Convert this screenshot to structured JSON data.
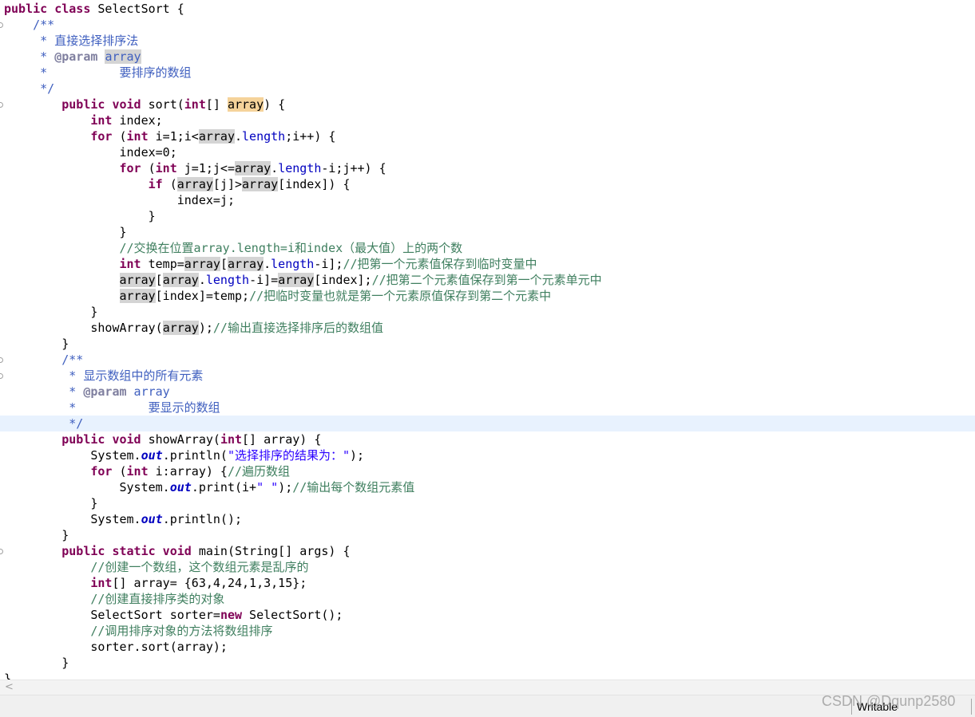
{
  "editor": {
    "current_line_index": 26,
    "fold_markers": [
      1,
      6,
      22,
      23,
      34
    ],
    "lines": [
      [
        {
          "c": "kw",
          "t": "public class"
        },
        {
          "c": "",
          "t": " SelectSort {"
        }
      ],
      [
        {
          "c": "",
          "t": "    "
        },
        {
          "c": "jd",
          "t": "/**"
        }
      ],
      [
        {
          "c": "jd",
          "t": "     * 直接选择排序法"
        }
      ],
      [
        {
          "c": "jd",
          "t": "     * "
        },
        {
          "c": "jt",
          "t": "@param"
        },
        {
          "c": "jd",
          "t": " "
        },
        {
          "c": "jd occ",
          "t": "array"
        }
      ],
      [
        {
          "c": "jd",
          "t": "     *          要排序的数组"
        }
      ],
      [
        {
          "c": "jd",
          "t": "     */"
        }
      ],
      [
        {
          "c": "",
          "t": "        "
        },
        {
          "c": "kw",
          "t": "public void"
        },
        {
          "c": "",
          "t": " sort("
        },
        {
          "c": "kw",
          "t": "int"
        },
        {
          "c": "",
          "t": "[] "
        },
        {
          "c": "occ-w",
          "t": "array"
        },
        {
          "c": "",
          "t": ") {"
        }
      ],
      [
        {
          "c": "",
          "t": "            "
        },
        {
          "c": "kw",
          "t": "int"
        },
        {
          "c": "",
          "t": " index;"
        }
      ],
      [
        {
          "c": "",
          "t": "            "
        },
        {
          "c": "kw",
          "t": "for"
        },
        {
          "c": "",
          "t": " ("
        },
        {
          "c": "kw",
          "t": "int"
        },
        {
          "c": "",
          "t": " i=1;i<"
        },
        {
          "c": "occ",
          "t": "array"
        },
        {
          "c": "",
          "t": "."
        },
        {
          "c": "fd",
          "t": "length"
        },
        {
          "c": "",
          "t": ";i++) {"
        }
      ],
      [
        {
          "c": "",
          "t": "                index=0;"
        }
      ],
      [
        {
          "c": "",
          "t": "                "
        },
        {
          "c": "kw",
          "t": "for"
        },
        {
          "c": "",
          "t": " ("
        },
        {
          "c": "kw",
          "t": "int"
        },
        {
          "c": "",
          "t": " j=1;j<="
        },
        {
          "c": "occ",
          "t": "array"
        },
        {
          "c": "",
          "t": "."
        },
        {
          "c": "fd",
          "t": "length"
        },
        {
          "c": "",
          "t": "-i;j++) {"
        }
      ],
      [
        {
          "c": "",
          "t": "                    "
        },
        {
          "c": "kw",
          "t": "if"
        },
        {
          "c": "",
          "t": " ("
        },
        {
          "c": "occ",
          "t": "array"
        },
        {
          "c": "",
          "t": "[j]>"
        },
        {
          "c": "occ",
          "t": "array"
        },
        {
          "c": "",
          "t": "[index]) {"
        }
      ],
      [
        {
          "c": "",
          "t": "                        index=j;"
        }
      ],
      [
        {
          "c": "",
          "t": "                    }"
        }
      ],
      [
        {
          "c": "",
          "t": "                }"
        }
      ],
      [
        {
          "c": "",
          "t": "                "
        },
        {
          "c": "cm",
          "t": "//交换在位置array.length=i和index（最大值）上的两个数"
        }
      ],
      [
        {
          "c": "",
          "t": "                "
        },
        {
          "c": "kw",
          "t": "int"
        },
        {
          "c": "",
          "t": " temp="
        },
        {
          "c": "occ",
          "t": "array"
        },
        {
          "c": "",
          "t": "["
        },
        {
          "c": "occ",
          "t": "array"
        },
        {
          "c": "",
          "t": "."
        },
        {
          "c": "fd",
          "t": "length"
        },
        {
          "c": "",
          "t": "-i];"
        },
        {
          "c": "cm",
          "t": "//把第一个元素值保存到临时变量中"
        }
      ],
      [
        {
          "c": "",
          "t": "                "
        },
        {
          "c": "occ",
          "t": "array"
        },
        {
          "c": "",
          "t": "["
        },
        {
          "c": "occ",
          "t": "array"
        },
        {
          "c": "",
          "t": "."
        },
        {
          "c": "fd",
          "t": "length"
        },
        {
          "c": "",
          "t": "-i]="
        },
        {
          "c": "occ",
          "t": "array"
        },
        {
          "c": "",
          "t": "[index];"
        },
        {
          "c": "cm",
          "t": "//把第二个元素值保存到第一个元素单元中"
        }
      ],
      [
        {
          "c": "",
          "t": "                "
        },
        {
          "c": "occ",
          "t": "array"
        },
        {
          "c": "",
          "t": "[index]=temp;"
        },
        {
          "c": "cm",
          "t": "//把临时变量也就是第一个元素原值保存到第二个元素中"
        }
      ],
      [
        {
          "c": "",
          "t": "            }"
        }
      ],
      [
        {
          "c": "",
          "t": "            showArray("
        },
        {
          "c": "occ",
          "t": "array"
        },
        {
          "c": "",
          "t": ");"
        },
        {
          "c": "cm",
          "t": "//输出直接选择排序后的数组值"
        }
      ],
      [
        {
          "c": "",
          "t": "        }"
        }
      ],
      [
        {
          "c": "",
          "t": "        "
        },
        {
          "c": "jd",
          "t": "/**"
        }
      ],
      [
        {
          "c": "jd",
          "t": "         * 显示数组中的所有元素"
        }
      ],
      [
        {
          "c": "jd",
          "t": "         * "
        },
        {
          "c": "jt",
          "t": "@param"
        },
        {
          "c": "jd",
          "t": " array"
        }
      ],
      [
        {
          "c": "jd",
          "t": "         *          要显示的数组"
        }
      ],
      [
        {
          "c": "jd",
          "t": "         */"
        }
      ],
      [
        {
          "c": "",
          "t": "        "
        },
        {
          "c": "kw",
          "t": "public void"
        },
        {
          "c": "",
          "t": " showArray("
        },
        {
          "c": "kw",
          "t": "int"
        },
        {
          "c": "",
          "t": "[] array) {"
        }
      ],
      [
        {
          "c": "",
          "t": "            System."
        },
        {
          "c": "sf",
          "t": "out"
        },
        {
          "c": "",
          "t": ".println("
        },
        {
          "c": "st",
          "t": "\"选择排序的结果为：\""
        },
        {
          "c": "",
          "t": ");"
        }
      ],
      [
        {
          "c": "",
          "t": "            "
        },
        {
          "c": "kw",
          "t": "for"
        },
        {
          "c": "",
          "t": " ("
        },
        {
          "c": "kw",
          "t": "int"
        },
        {
          "c": "",
          "t": " i:array) {"
        },
        {
          "c": "cm",
          "t": "//遍历数组"
        }
      ],
      [
        {
          "c": "",
          "t": "                System."
        },
        {
          "c": "sf",
          "t": "out"
        },
        {
          "c": "",
          "t": ".print(i+"
        },
        {
          "c": "st",
          "t": "\" \""
        },
        {
          "c": "",
          "t": ");"
        },
        {
          "c": "cm",
          "t": "//输出每个数组元素值"
        }
      ],
      [
        {
          "c": "",
          "t": "            }"
        }
      ],
      [
        {
          "c": "",
          "t": "            System."
        },
        {
          "c": "sf",
          "t": "out"
        },
        {
          "c": "",
          "t": ".println();"
        }
      ],
      [
        {
          "c": "",
          "t": "        }"
        }
      ],
      [
        {
          "c": "",
          "t": "        "
        },
        {
          "c": "kw",
          "t": "public static void"
        },
        {
          "c": "",
          "t": " main(String[] args) {"
        }
      ],
      [
        {
          "c": "",
          "t": "            "
        },
        {
          "c": "cm",
          "t": "//创建一个数组，这个数组元素是乱序的"
        }
      ],
      [
        {
          "c": "",
          "t": "            "
        },
        {
          "c": "kw",
          "t": "int"
        },
        {
          "c": "",
          "t": "[] array= {63,4,24,1,3,15};"
        }
      ],
      [
        {
          "c": "",
          "t": "            "
        },
        {
          "c": "cm",
          "t": "//创建直接排序类的对象"
        }
      ],
      [
        {
          "c": "",
          "t": "            SelectSort sorter="
        },
        {
          "c": "kw",
          "t": "new"
        },
        {
          "c": "",
          "t": " SelectSort();"
        }
      ],
      [
        {
          "c": "",
          "t": "            "
        },
        {
          "c": "cm",
          "t": "//调用排序对象的方法将数组排序"
        }
      ],
      [
        {
          "c": "",
          "t": "            sorter.sort(array);"
        }
      ],
      [
        {
          "c": "",
          "t": "        }"
        }
      ],
      [
        {
          "c": "",
          "t": "}"
        }
      ]
    ]
  },
  "scrollbar": {
    "left_arrow": "<"
  },
  "status": {
    "writable": "Writable"
  },
  "watermark": "CSDN @Dqunp2580"
}
